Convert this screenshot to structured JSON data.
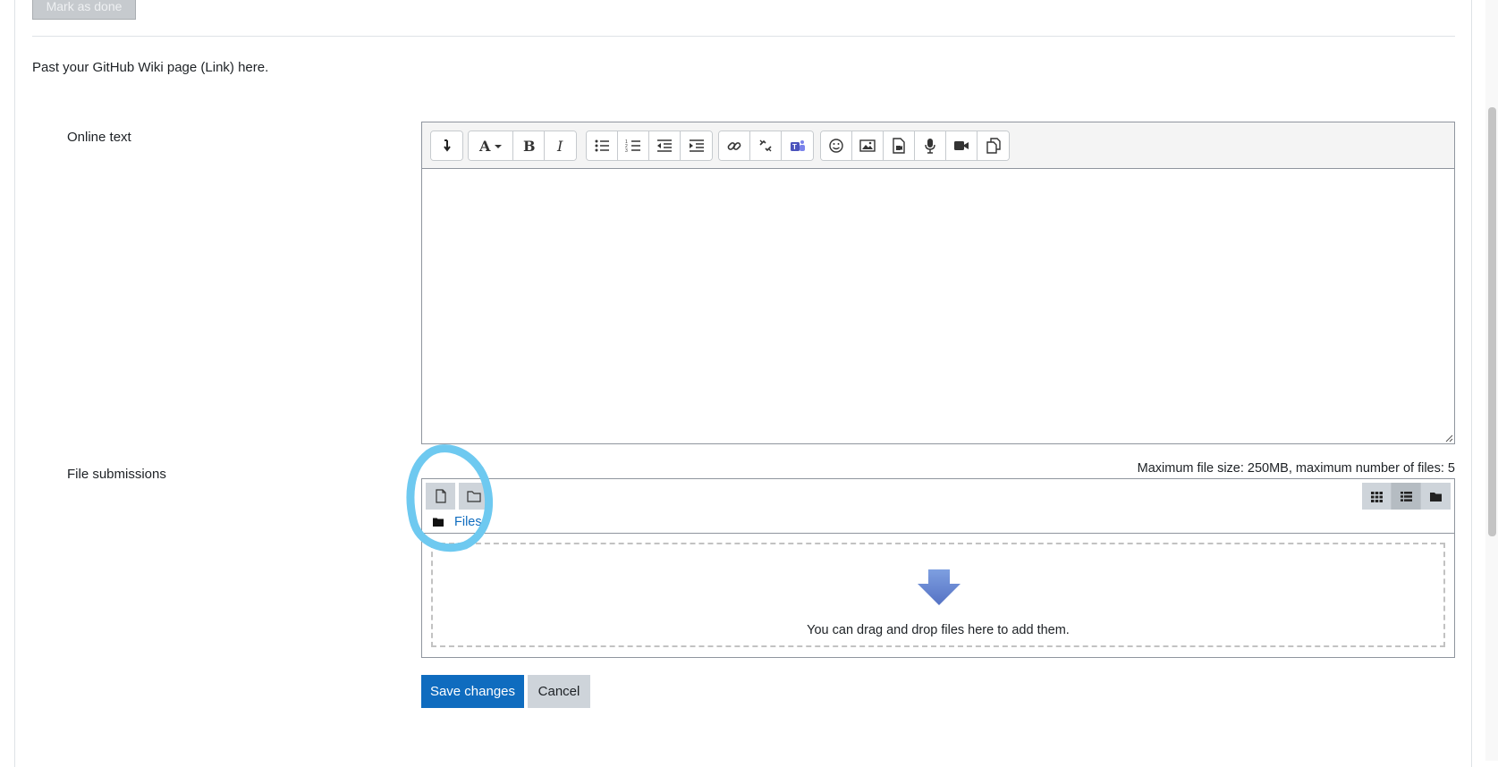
{
  "top": {
    "mark_done_label": "Mark as done"
  },
  "intro_text": "Past your GitHub Wiki page (Link) here.",
  "online_text": {
    "label": "Online text",
    "toolbar_groups": [
      [
        "toggle-toolbar-icon"
      ],
      [
        "font-style-icon",
        "bold-icon",
        "italic-icon"
      ],
      [
        "unordered-list-icon",
        "ordered-list-icon",
        "outdent-icon",
        "indent-icon"
      ],
      [
        "link-icon",
        "unlink-icon",
        "teams-meeting-icon"
      ],
      [
        "emoji-icon",
        "image-icon",
        "media-icon",
        "record-audio-icon",
        "record-video-icon",
        "manage-files-icon"
      ]
    ],
    "content": ""
  },
  "file_submissions": {
    "label": "File submissions",
    "limits_text": "Maximum file size: 250MB, maximum number of files: 5",
    "add_file_icon": "add-file-icon",
    "create_folder_icon": "create-folder-icon",
    "view_icons": [
      "icon-view-icon",
      "list-view-icon",
      "tree-view-icon"
    ],
    "active_view": "list-view-icon",
    "path_label": "Files",
    "drop_text": "You can drag and drop files here to add them."
  },
  "annotation": {
    "color": "#6ec9f0",
    "shape": "hand-drawn circle"
  },
  "buttons": {
    "save_label": "Save changes",
    "cancel_label": "Cancel"
  },
  "colors": {
    "primary": "#0f6cbf",
    "secondary": "#ced4da",
    "link": "#0f6cbf"
  }
}
